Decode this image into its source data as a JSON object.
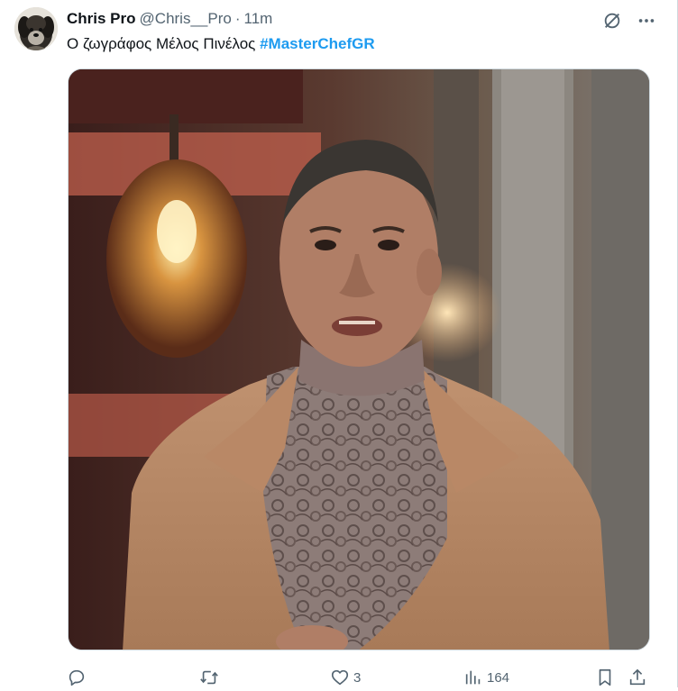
{
  "tweet": {
    "author": {
      "display_name": "Chris Pro",
      "handle": "@Chris__Pro",
      "avatar_icon": "dog-avatar-icon"
    },
    "separator": "·",
    "timestamp": "11m",
    "text": "Ο  ζωγράφος Μέλος Πινέλος",
    "hashtag": "#MasterChefGR",
    "hashtag_color": "#1d9bf0",
    "top_icons": [
      "grok-icon",
      "more-icon"
    ],
    "media": {
      "type": "photo",
      "subject": "man in tan shirt and lace turtleneck"
    },
    "actions": {
      "reply": {
        "icon": "reply-icon",
        "count": ""
      },
      "retweet": {
        "icon": "retweet-icon",
        "count": ""
      },
      "like": {
        "icon": "heart-icon",
        "count": "3"
      },
      "views": {
        "icon": "views-icon",
        "count": "164"
      },
      "bookmark": {
        "icon": "bookmark-icon"
      },
      "share": {
        "icon": "share-icon"
      }
    }
  },
  "colors": {
    "text_primary": "#0f1419",
    "text_secondary": "#536471",
    "border": "#cfd9de"
  }
}
